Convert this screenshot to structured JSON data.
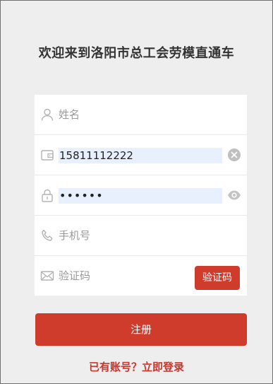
{
  "header": {
    "title": "欢迎来到洛阳市总工会劳模直通车"
  },
  "form": {
    "name_placeholder": "姓名",
    "id_value": "15811112222",
    "password_value": "••••••",
    "phone_placeholder": "手机号",
    "code_placeholder": "验证码",
    "code_button_label": "验证码"
  },
  "actions": {
    "register_label": "注册",
    "login_link": "已有账号？立即登录"
  },
  "colors": {
    "accent": "#d03c2c",
    "background": "#eeeeee",
    "autofill": "#e8f0fe"
  },
  "icons": {
    "name": "user-icon",
    "id": "card-wallet-icon",
    "password": "lock-icon",
    "clear": "clear-icon",
    "visibility": "eye-icon",
    "phone": "phone-icon",
    "code": "mail-icon"
  }
}
